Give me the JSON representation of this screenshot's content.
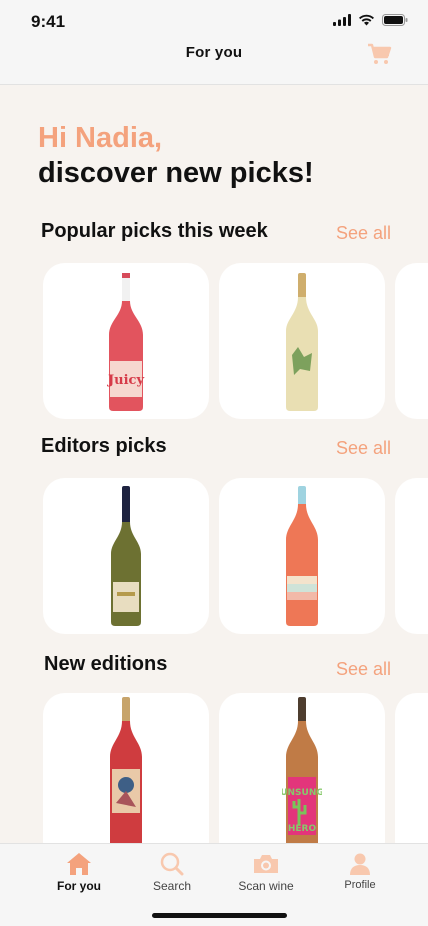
{
  "status": {
    "time": "9:41"
  },
  "header": {
    "title": "For you"
  },
  "greeting": {
    "hi": "Hi Nadia,",
    "sub": "discover new picks!"
  },
  "sections": [
    {
      "title": "Popular picks this week",
      "see_all": "See all"
    },
    {
      "title": "Editors picks",
      "see_all": "See all"
    },
    {
      "title": "New editions",
      "see_all": "See all"
    }
  ],
  "bottle_labels": {
    "juicy": "Juicy",
    "unsung": "UNSUNG",
    "hero": "HERO"
  },
  "tabs": [
    {
      "label": "For you",
      "icon": "home-icon"
    },
    {
      "label": "Search",
      "icon": "search-icon"
    },
    {
      "label": "Scan wine",
      "icon": "camera-icon"
    },
    {
      "label": "Profile",
      "icon": "profile-icon"
    }
  ],
  "colors": {
    "accent": "#f4a27d",
    "background": "#f7f3ef"
  }
}
